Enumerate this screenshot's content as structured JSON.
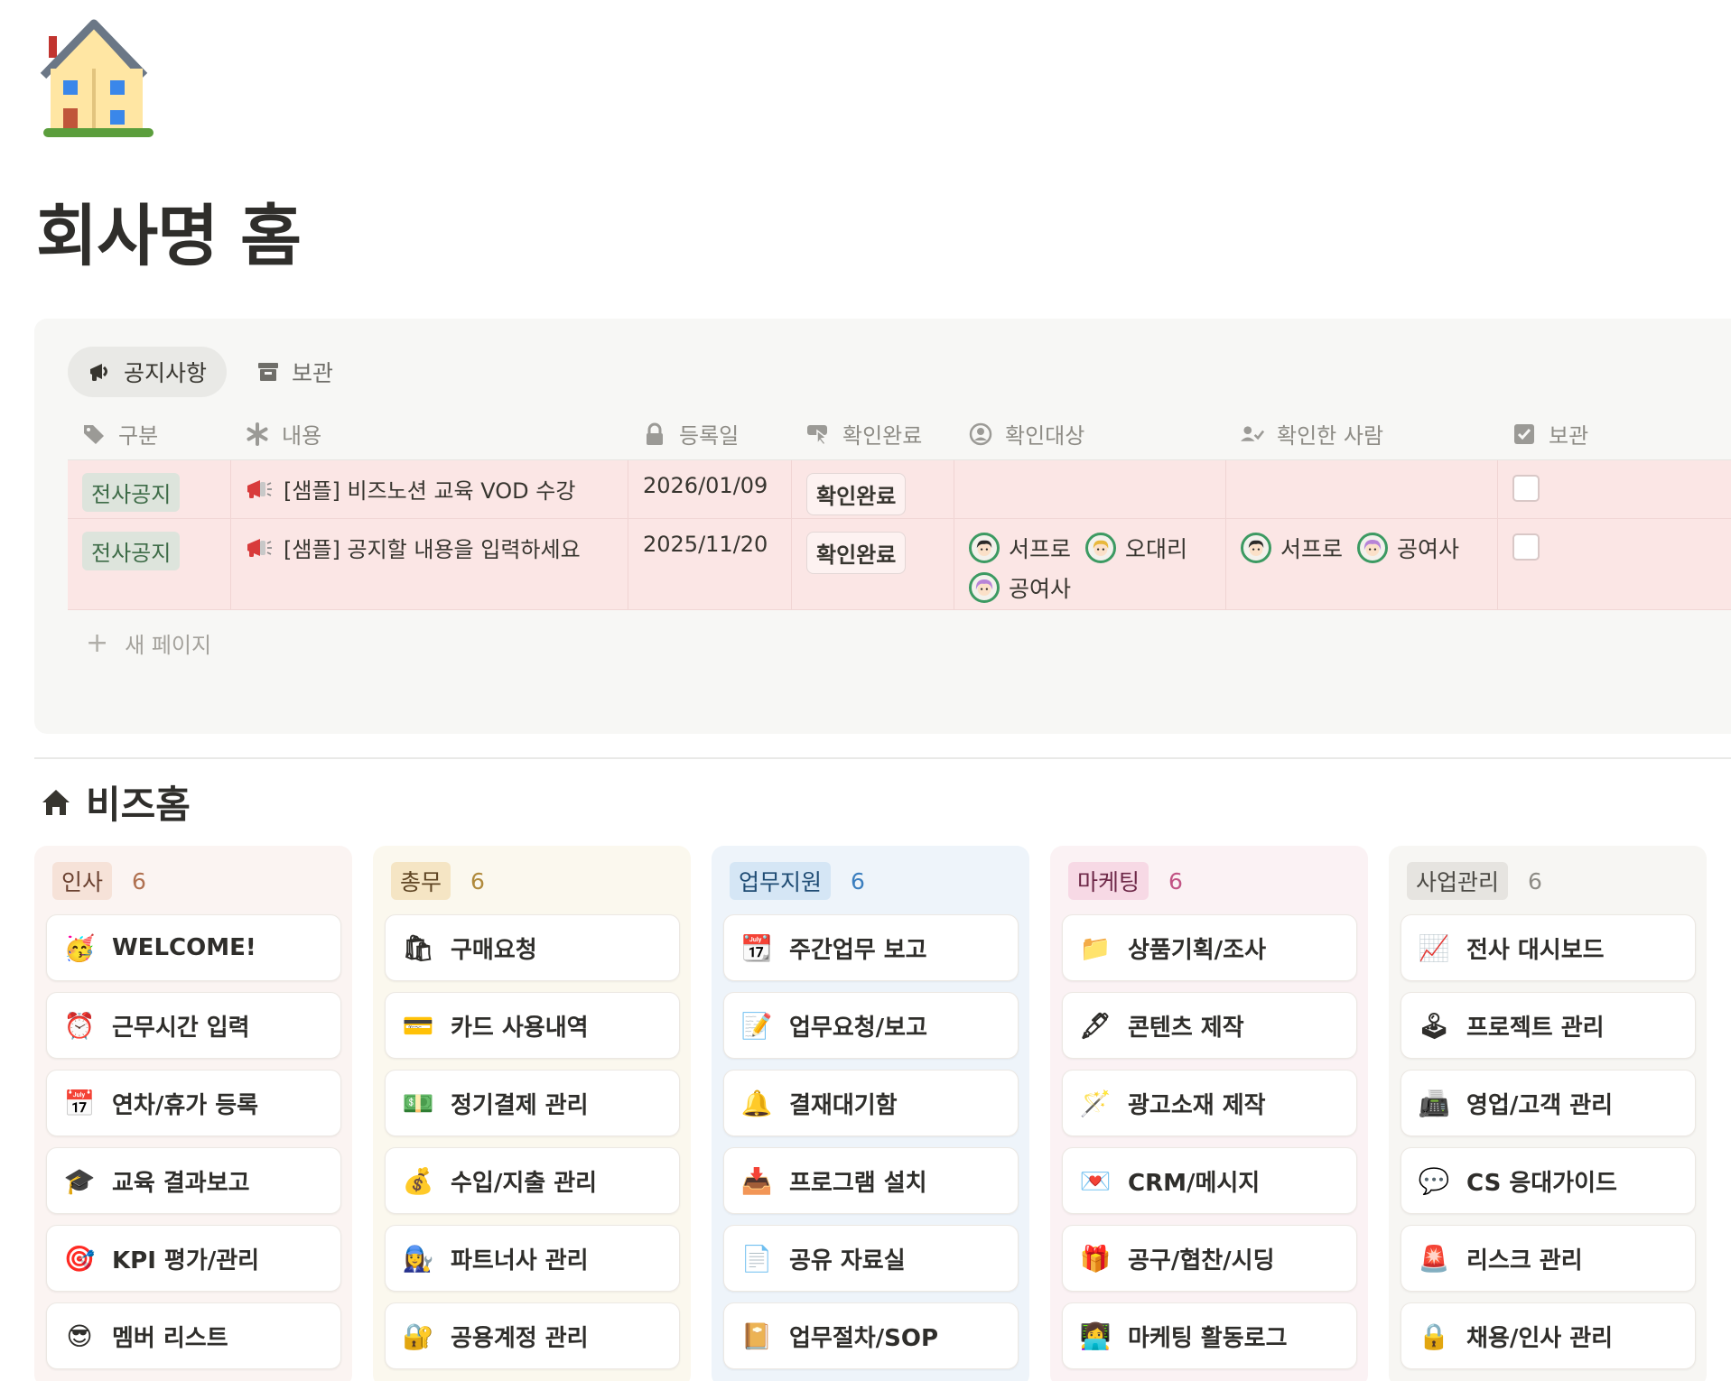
{
  "page": {
    "title": "회사명 홈"
  },
  "notice": {
    "tabs": [
      {
        "label": "공지사항",
        "icon": "megaphone-icon",
        "active": true
      },
      {
        "label": "보관",
        "icon": "archive-box-icon",
        "active": false
      }
    ],
    "columns": [
      {
        "label": "구분",
        "icon": "tag-icon"
      },
      {
        "label": "내용",
        "icon": "asterisk-icon"
      },
      {
        "label": "등록일",
        "icon": "lock-icon"
      },
      {
        "label": "확인완료",
        "icon": "pointer-button-icon"
      },
      {
        "label": "확인대상",
        "icon": "person-circle-icon"
      },
      {
        "label": "확인한 사람",
        "icon": "person-check-icon"
      },
      {
        "label": "보관",
        "icon": "checkbox-icon"
      }
    ],
    "rows": [
      {
        "category": "전사공지",
        "title": "[샘플] 비즈노션 교육 VOD 수강",
        "date": "2026/01/09",
        "confirm_button": "확인완료",
        "targets": [],
        "confirmed_by": [],
        "archived": false
      },
      {
        "category": "전사공지",
        "title": "[샘플] 공지할 내용을 입력하세요",
        "date": "2025/11/20",
        "confirm_button": "확인완료",
        "targets": [
          "서프로",
          "오대리",
          "공여사"
        ],
        "confirmed_by": [
          "서프로",
          "공여사"
        ],
        "archived": false
      }
    ],
    "new_page": "새 페이지"
  },
  "section": {
    "title": "비즈홈",
    "icon": "home-icon"
  },
  "board": {
    "columns": [
      {
        "label": "인사",
        "count": "6",
        "colors": {
          "bg": "#fbf4f2",
          "label_bg": "#f6e2d8",
          "label_fg": "#6b4130",
          "count_fg": "#b07151"
        },
        "cards": [
          {
            "label": "WELCOME!",
            "icon": "party-face-icon",
            "glyph": "🥳"
          },
          {
            "label": "근무시간 입력",
            "icon": "alarm-clock-icon",
            "glyph": "⏰"
          },
          {
            "label": "연차/휴가 등록",
            "icon": "calendar-icon",
            "glyph": "📅"
          },
          {
            "label": "교육 결과보고",
            "icon": "graduation-cap-icon",
            "glyph": "🎓"
          },
          {
            "label": "KPI 평가/관리",
            "icon": "target-icon",
            "glyph": "🎯"
          },
          {
            "label": "멤버 리스트",
            "icon": "sunglasses-face-icon",
            "glyph": "😎"
          }
        ]
      },
      {
        "label": "총무",
        "count": "6",
        "colors": {
          "bg": "#fbf8ee",
          "label_bg": "#f5e5c4",
          "label_fg": "#5f4523",
          "count_fg": "#b08a3c"
        },
        "cards": [
          {
            "label": "구매요청",
            "icon": "shopping-bags-icon",
            "glyph": "🛍"
          },
          {
            "label": "카드 사용내역",
            "icon": "credit-card-icon",
            "glyph": "💳"
          },
          {
            "label": "정기결제 관리",
            "icon": "dollar-banknote-icon",
            "glyph": "💵"
          },
          {
            "label": "수입/지출 관리",
            "icon": "money-bag-icon",
            "glyph": "💰"
          },
          {
            "label": "파트너사 관리",
            "icon": "mechanic-icon",
            "glyph": "👩‍🔧"
          },
          {
            "label": "공용계정 관리",
            "icon": "locked-with-key-icon",
            "glyph": "🔐"
          }
        ]
      },
      {
        "label": "업무지원",
        "count": "6",
        "colors": {
          "bg": "#eef4fa",
          "label_bg": "#d5e6f5",
          "label_fg": "#1f4c74",
          "count_fg": "#3c7fbf"
        },
        "cards": [
          {
            "label": "주간업무 보고",
            "icon": "tear-off-calendar-icon",
            "glyph": "📆"
          },
          {
            "label": "업무요청/보고",
            "icon": "memo-icon",
            "glyph": "📝"
          },
          {
            "label": "결재대기함",
            "icon": "bell-icon",
            "glyph": "🔔"
          },
          {
            "label": "프로그램 설치",
            "icon": "inbox-tray-icon",
            "glyph": "📥"
          },
          {
            "label": "공유 자료실",
            "icon": "page-facing-up-icon",
            "glyph": "📄"
          },
          {
            "label": "업무절차/SOP",
            "icon": "notebook-icon",
            "glyph": "📔"
          }
        ]
      },
      {
        "label": "마케팅",
        "count": "6",
        "colors": {
          "bg": "#fbf2f4",
          "label_bg": "#f7d9e5",
          "label_fg": "#6e2848",
          "count_fg": "#c25585"
        },
        "cards": [
          {
            "label": "상품기획/조사",
            "icon": "file-folder-icon",
            "glyph": "📁"
          },
          {
            "label": "콘텐츠 제작",
            "icon": "fountain-pen-icon",
            "glyph": "🖋"
          },
          {
            "label": "광고소재 제작",
            "icon": "magic-wand-icon",
            "glyph": "🪄"
          },
          {
            "label": "CRM/메시지",
            "icon": "love-letter-icon",
            "glyph": "💌"
          },
          {
            "label": "공구/협찬/시딩",
            "icon": "gift-icon",
            "glyph": "🎁"
          },
          {
            "label": "마케팅 활동로그",
            "icon": "person-at-computer-icon",
            "glyph": "👩‍💻"
          }
        ]
      },
      {
        "label": "사업관리",
        "count": "6",
        "colors": {
          "bg": "#f7f6f3",
          "label_bg": "#e6e4e0",
          "label_fg": "#4b4944",
          "count_fg": "#8e8c86"
        },
        "cards": [
          {
            "label": "전사 대시보드",
            "icon": "chart-increasing-icon",
            "glyph": "📈"
          },
          {
            "label": "프로젝트 관리",
            "icon": "joystick-icon",
            "glyph": "🕹"
          },
          {
            "label": "영업/고객 관리",
            "icon": "fax-machine-icon",
            "glyph": "📠"
          },
          {
            "label": "CS 응대가이드",
            "icon": "speech-balloon-icon",
            "glyph": "💬"
          },
          {
            "label": "리스크 관리",
            "icon": "police-light-icon",
            "glyph": "🚨"
          },
          {
            "label": "채용/인사 관리",
            "icon": "lock-icon",
            "glyph": "🔒"
          }
        ]
      }
    ]
  }
}
